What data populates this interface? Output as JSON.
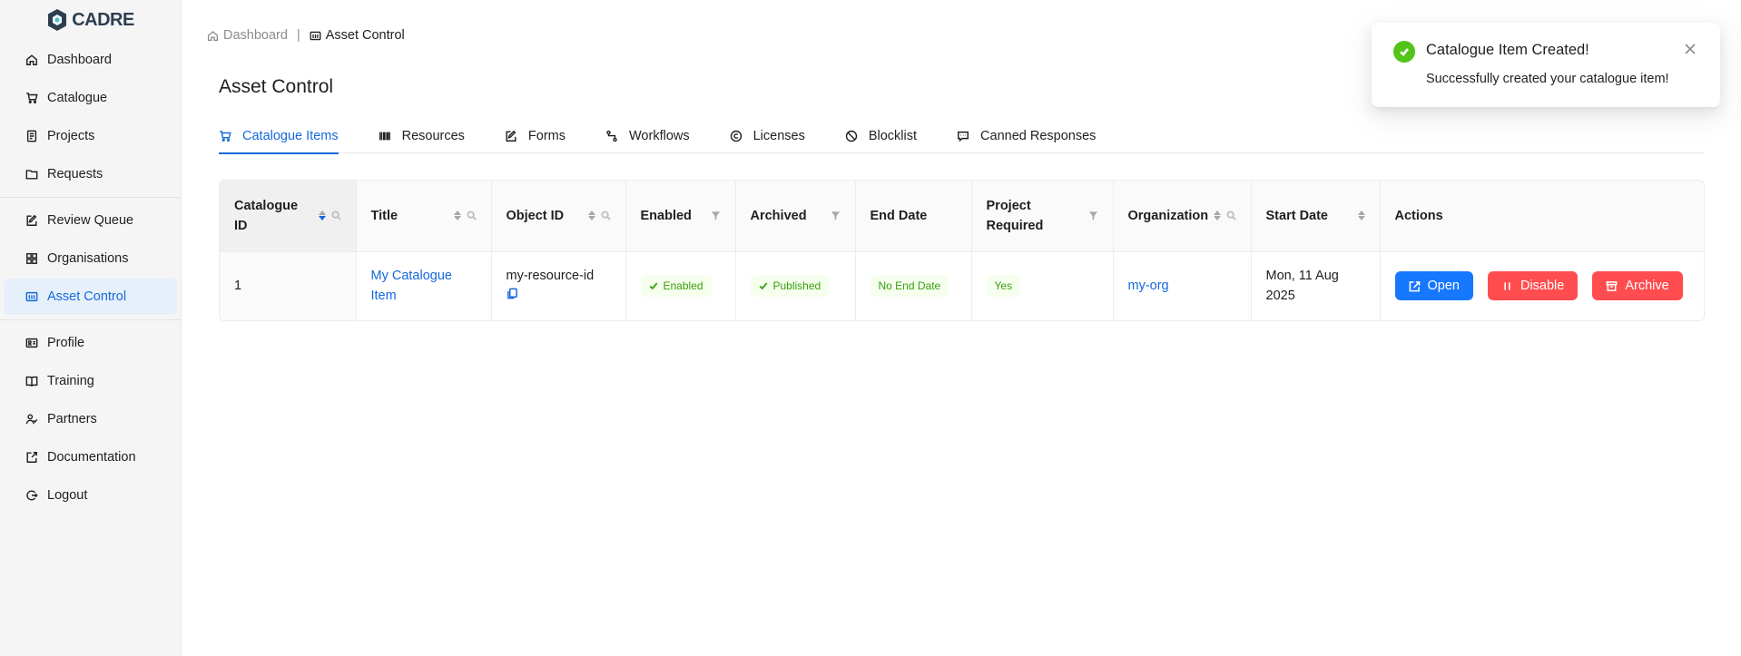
{
  "app": {
    "logo_text": "CADRE"
  },
  "sidebar": {
    "group1": [
      {
        "label": "Dashboard",
        "icon": "home-icon"
      },
      {
        "label": "Catalogue",
        "icon": "cart-icon"
      },
      {
        "label": "Projects",
        "icon": "projects-icon"
      },
      {
        "label": "Requests",
        "icon": "folder-icon"
      }
    ],
    "group2": [
      {
        "label": "Review Queue",
        "icon": "edit-icon"
      },
      {
        "label": "Organisations",
        "icon": "grid-icon"
      },
      {
        "label": "Asset Control",
        "icon": "asset-icon",
        "active": true
      }
    ],
    "group3": [
      {
        "label": "Profile",
        "icon": "profile-icon"
      },
      {
        "label": "Training",
        "icon": "training-icon"
      },
      {
        "label": "Partners",
        "icon": "partners-icon"
      },
      {
        "label": "Documentation",
        "icon": "external-link-icon"
      },
      {
        "label": "Logout",
        "icon": "logout-icon"
      }
    ]
  },
  "breadcrumb": {
    "home": "Dashboard",
    "separator": "|",
    "current": "Asset Control"
  },
  "page": {
    "title": "Asset Control"
  },
  "tabs": [
    {
      "label": "Catalogue Items",
      "icon": "cart-icon",
      "active": true
    },
    {
      "label": "Resources",
      "icon": "barcode-icon"
    },
    {
      "label": "Forms",
      "icon": "form-icon"
    },
    {
      "label": "Workflows",
      "icon": "workflow-icon"
    },
    {
      "label": "Licenses",
      "icon": "copyright-icon"
    },
    {
      "label": "Blocklist",
      "icon": "block-icon"
    },
    {
      "label": "Canned Responses",
      "icon": "chat-icon"
    }
  ],
  "table": {
    "columns": {
      "catalogue_id": "Catalogue ID",
      "title": "Title",
      "object_id": "Object ID",
      "enabled": "Enabled",
      "archived": "Archived",
      "end_date": "End Date",
      "project_required": "Project Required",
      "organization": "Organization",
      "start_date": "Start Date",
      "actions": "Actions"
    },
    "rows": [
      {
        "catalogue_id": "1",
        "title": "My Catalogue Item",
        "object_id": "my-resource-id",
        "enabled": "Enabled",
        "archived": "Published",
        "end_date": "No End Date",
        "project_required": "Yes",
        "organization": "my-org",
        "start_date": "Mon, 11 Aug 2025",
        "actions": {
          "open": "Open",
          "disable": "Disable",
          "archive": "Archive"
        }
      }
    ]
  },
  "toast": {
    "title": "Catalogue Item Created!",
    "message": "Successfully created your catalogue item!"
  },
  "colors": {
    "primary": "#1677ff",
    "danger": "#ff4d4f",
    "success": "#52c41a",
    "tag_green": "#389e0d"
  }
}
